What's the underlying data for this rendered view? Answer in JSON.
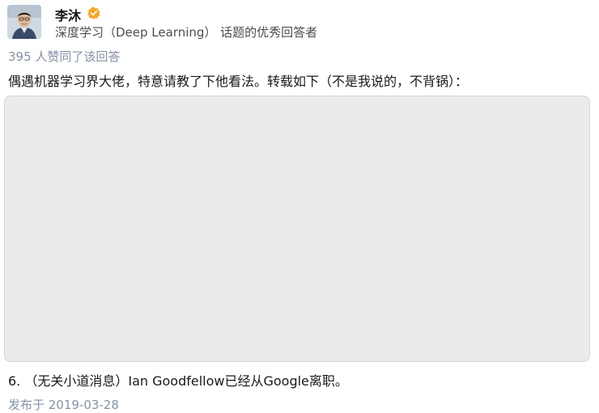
{
  "author": {
    "name": "李沐",
    "description": "深度学习（Deep Learning） 话题的优秀回答者",
    "badge_icon": "excellent-answerer-badge-icon",
    "badge_color": "#f5a623"
  },
  "answer": {
    "vote_text": "395 人赞同了该回答",
    "intro": "偶遇机器学习界大佬，特意请教了下他看法。转载如下（不是我说的，不背锅）：",
    "last_line": "6. （无关小道消息）Ian Goodfellow已经从Google离职。",
    "publish_date": "发布于 2019-03-28"
  },
  "colors": {
    "meta_text": "#8590a6",
    "body_text": "#1a1a1a",
    "image_placeholder": "#ebebeb"
  }
}
